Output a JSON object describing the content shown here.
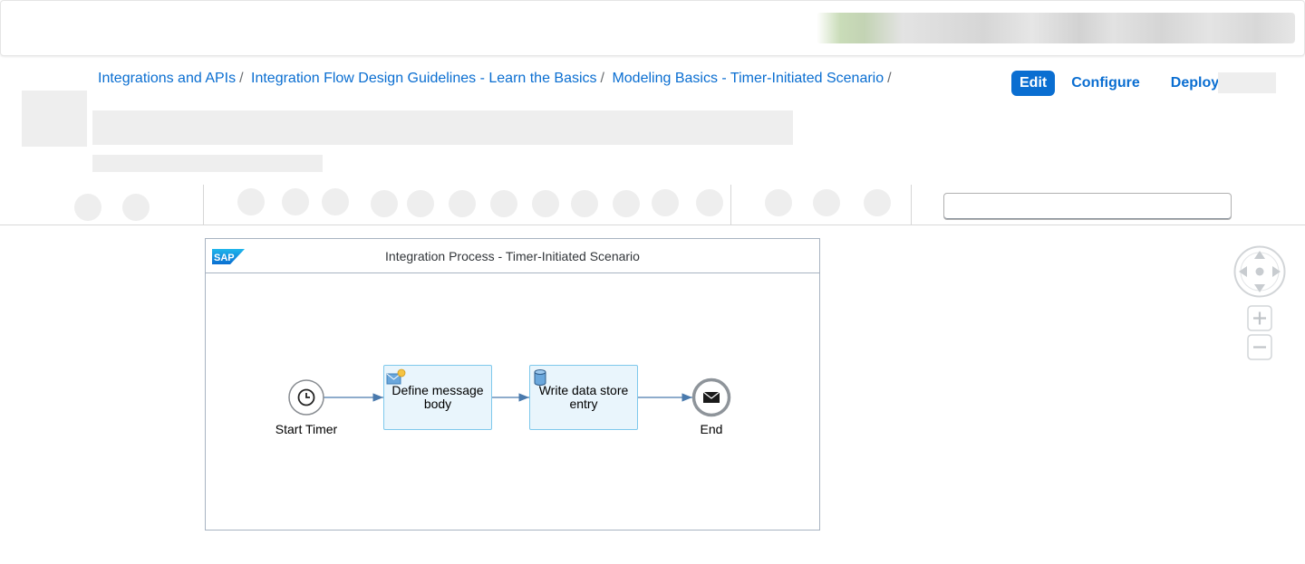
{
  "breadcrumb": {
    "items": [
      "Integrations and APIs",
      "Integration Flow Design Guidelines - Learn the Basics",
      "Modeling Basics - Timer-Initiated Scenario"
    ],
    "separator": "/"
  },
  "actions": {
    "edit": "Edit",
    "configure": "Configure",
    "deploy": "Deploy"
  },
  "search": {
    "value": "",
    "placeholder": ""
  },
  "diagram": {
    "pool_title": "Integration Process - Timer-Initiated Scenario",
    "logo_text": "SAP",
    "start_event": "Start Timer",
    "step1": "Define message body",
    "step2": "Write data store entry",
    "end_event": "End"
  },
  "icons": {
    "pan": "navigation-pad-icon",
    "zoom_in": "zoom-in-icon",
    "zoom_out": "zoom-out-icon",
    "timer": "clock-icon",
    "end": "envelope-icon"
  },
  "colors": {
    "brand_blue": "#0a6ed1",
    "step_fill": "#e9f5fc",
    "step_border": "#7ec8ec",
    "connector": "#4a7aad"
  }
}
